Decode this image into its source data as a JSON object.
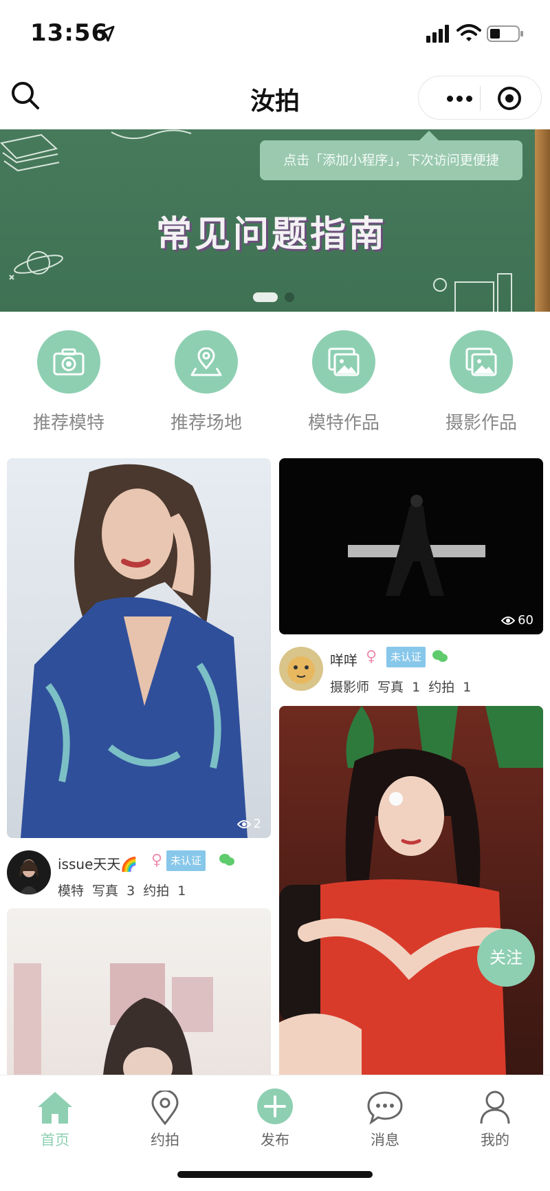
{
  "status_bar": {
    "time": "13:56"
  },
  "nav": {
    "title": "汝拍"
  },
  "banner": {
    "headline": "常见问题指南",
    "tip": "点击「添加小程序」，下次访问更便捷",
    "slide_count": 2,
    "active_slide": 1
  },
  "categories": [
    {
      "label": "推荐模特",
      "icon": "camera-icon"
    },
    {
      "label": "推荐场地",
      "icon": "map-pin-icon"
    },
    {
      "label": "模特作品",
      "icon": "image-icon"
    },
    {
      "label": "摄影作品",
      "icon": "image-icon"
    }
  ],
  "feed": {
    "left": [
      {
        "views": "2",
        "user": "issue天天🌈",
        "gender": "♀",
        "badge": "未认证",
        "stats": "模特  写真 3  约拍 1"
      }
    ],
    "right": [
      {
        "views": "60",
        "user": "咩咩",
        "gender": "♀",
        "badge": "未认证",
        "stats": "摄影师  写真 1  约拍 1"
      }
    ]
  },
  "follow_label": "关注",
  "tabbar": [
    {
      "label": "首页",
      "icon": "home-icon",
      "active": true
    },
    {
      "label": "约拍",
      "icon": "location-icon",
      "active": false
    },
    {
      "label": "发布",
      "icon": "plus-circle-icon",
      "active": false
    },
    {
      "label": "消息",
      "icon": "chat-icon",
      "active": false
    },
    {
      "label": "我的",
      "icon": "user-icon",
      "active": false
    }
  ],
  "colors": {
    "accent": "#8ecfb2",
    "badge": "#87c7ea",
    "banner": "#477a5b"
  }
}
